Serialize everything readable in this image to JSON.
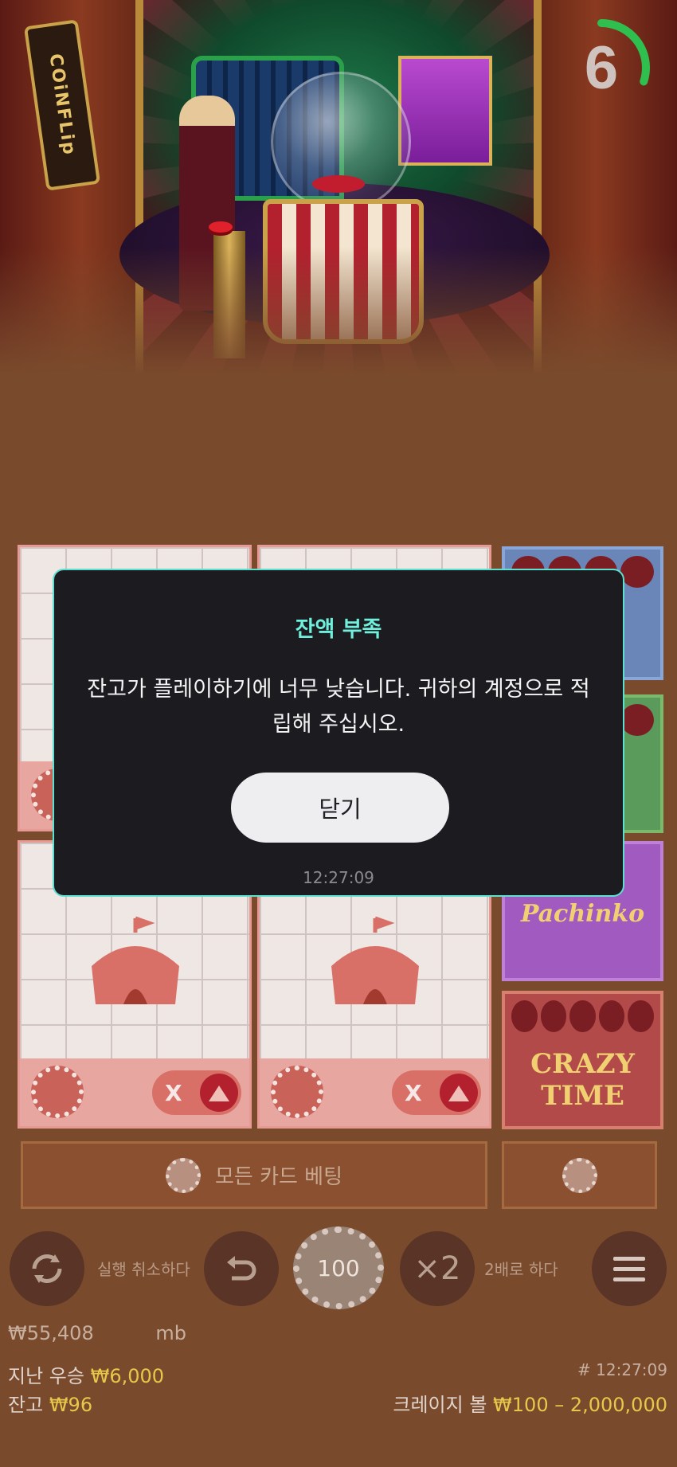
{
  "timer": {
    "seconds": "6",
    "progress": 0.3,
    "color": "#2fbf4f"
  },
  "video": {
    "sign_left": "COiNFLip"
  },
  "board": {
    "cards": [
      {
        "multiplier": "X"
      },
      {
        "multiplier": "X"
      }
    ],
    "side_tiles": [
      {
        "label": ""
      },
      {
        "label": ""
      },
      {
        "label": "Pachinko"
      },
      {
        "label": "CRAZY TIME"
      }
    ],
    "all_cards_bet": "모든 카드 베팅"
  },
  "controls": {
    "undo_label": "실행 취소하다",
    "chip_value": "100",
    "double_symbol": "×2",
    "double_label": "2배로 하다"
  },
  "info": {
    "ticker": "₩55,408",
    "ticker_user": "mb",
    "last_win_label": "지난 우승",
    "last_win_value": "₩6,000",
    "balance_label": "잔고",
    "balance_value": "₩96",
    "round_time": "# 12:27:09",
    "game_name": "크레이지 볼",
    "bet_range": "₩100 – 2,000,000"
  },
  "modal": {
    "title": "잔액 부족",
    "message": "잔고가 플레이하기에 너무 낮습니다. 귀하의 계정으로 적립해 주십시오.",
    "close_label": "닫기",
    "timestamp": "12:27:09"
  },
  "colors": {
    "accent": "#5ee0d0",
    "gold": "#e8c84a"
  }
}
